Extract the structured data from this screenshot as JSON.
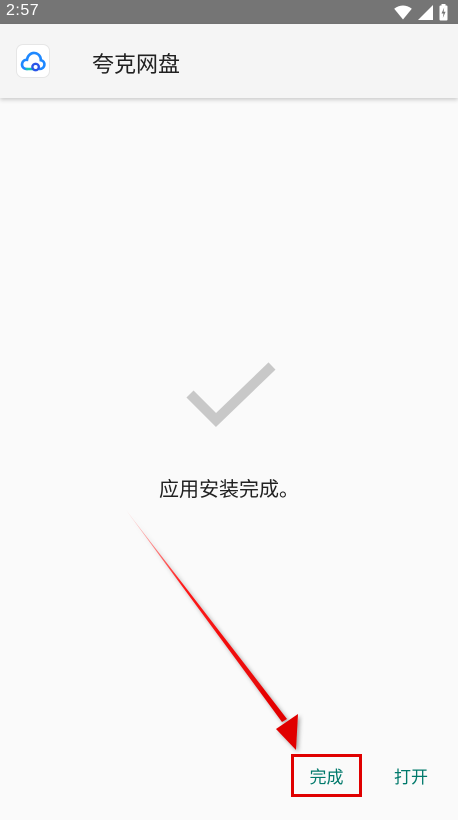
{
  "status_bar": {
    "time": "2:57"
  },
  "app_bar": {
    "title": "夸克网盘"
  },
  "content": {
    "message": "应用安装完成。"
  },
  "buttons": {
    "done_label": "完成",
    "open_label": "打开"
  },
  "colors": {
    "status_bar_bg": "#757575",
    "accent": "#00796b",
    "annotation": "#e00000",
    "check": "#c8c8c8"
  }
}
